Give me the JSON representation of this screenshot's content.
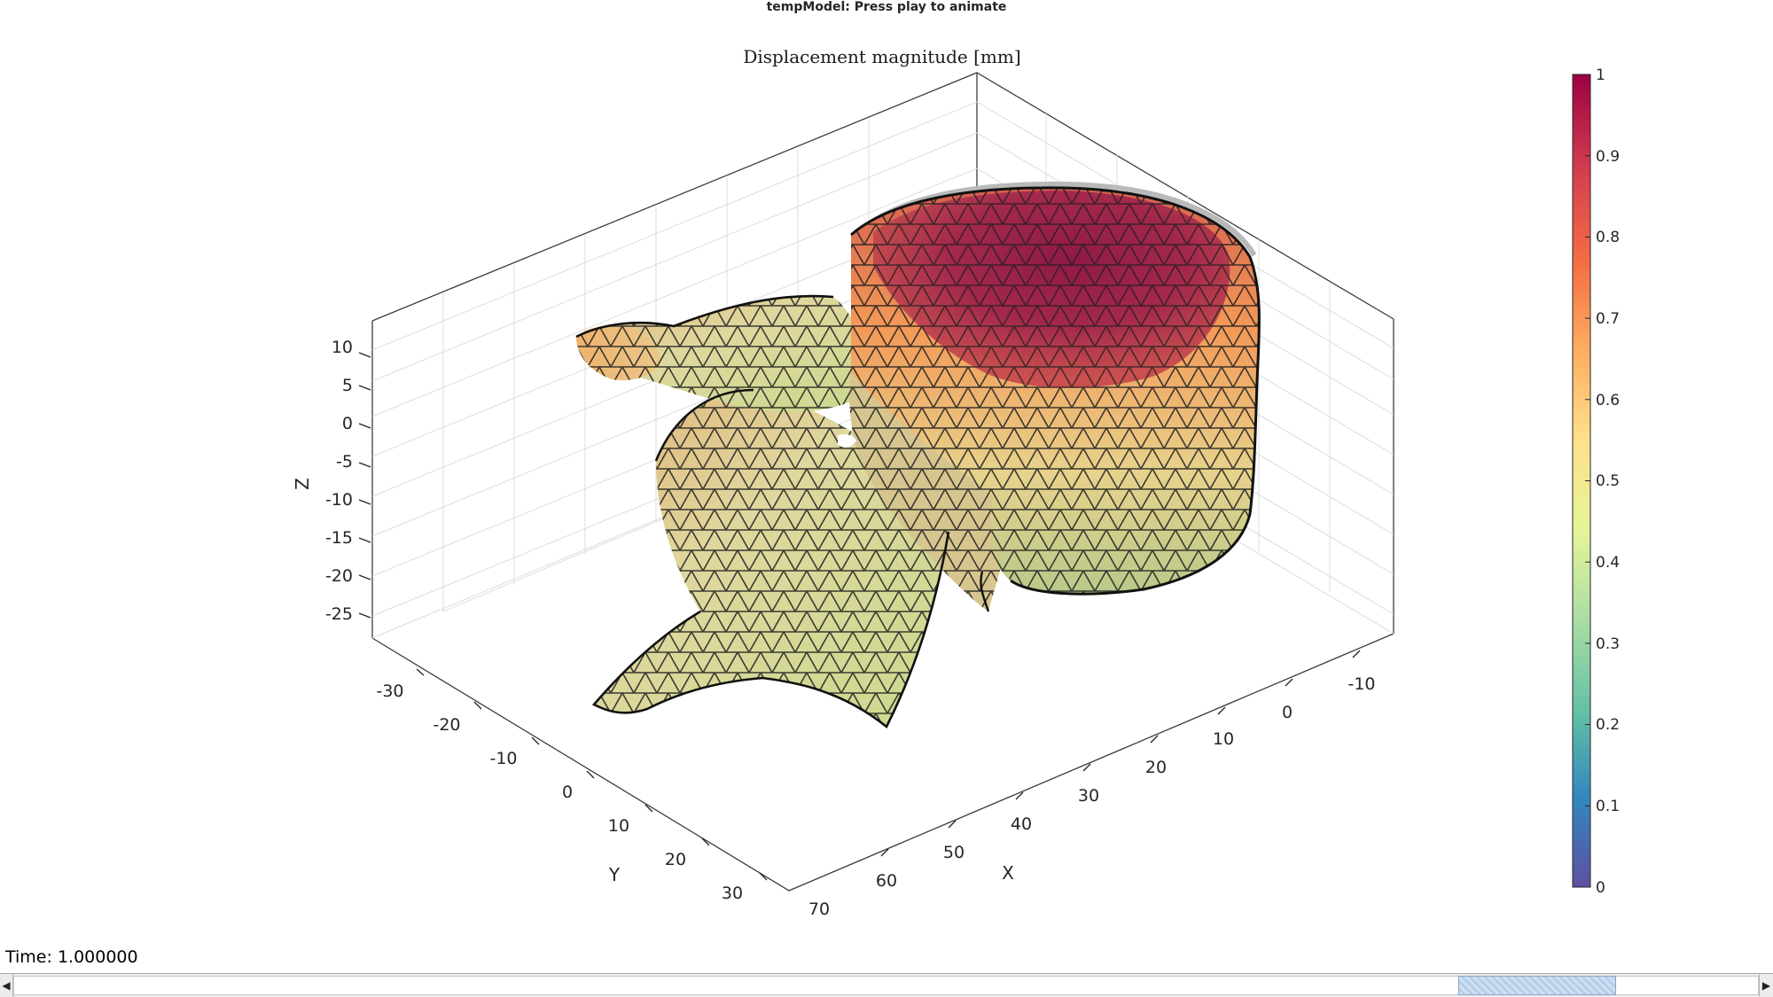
{
  "window": {
    "title": "tempModel: Press play to animate"
  },
  "plot": {
    "title": "Displacement magnitude [mm]",
    "x_axis": {
      "label": "X",
      "ticks": [
        "70",
        "60",
        "50",
        "40",
        "30",
        "20",
        "10",
        "0",
        "-10"
      ]
    },
    "y_axis": {
      "label": "Y",
      "ticks": [
        "-30",
        "-20",
        "-10",
        "0",
        "10",
        "20",
        "30"
      ]
    },
    "z_axis": {
      "label": "Z",
      "ticks": [
        "10",
        "5",
        "0",
        "-5",
        "-10",
        "-15",
        "-20",
        "-25"
      ]
    },
    "surface_description": "vertebra mesh colored by displacement magnitude",
    "colormap": [
      "#5e4fa2",
      "#3288bd",
      "#66c2a5",
      "#abdda4",
      "#e6f598",
      "#fee08b",
      "#fdae61",
      "#f46d43",
      "#d53e4f",
      "#9e0142"
    ]
  },
  "colorbar": {
    "ticks": [
      "1",
      "0.9",
      "0.8",
      "0.7",
      "0.6",
      "0.5",
      "0.4",
      "0.3",
      "0.2",
      "0.1",
      "0"
    ]
  },
  "status": {
    "time_label": "Time: 1.000000"
  },
  "scrollbar": {
    "left_arrow": "◀",
    "right_arrow": "▶",
    "position": 0.91
  }
}
